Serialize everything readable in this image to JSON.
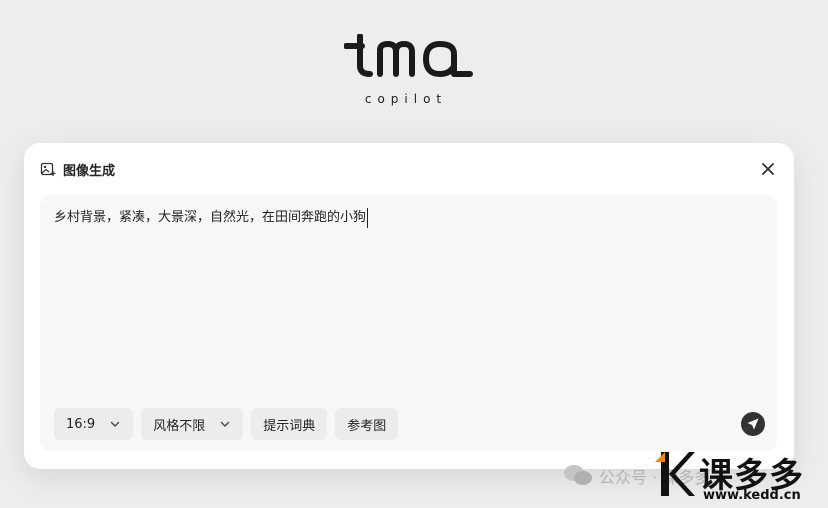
{
  "logo": {
    "wordmark": "ima",
    "subtitle": "copilot"
  },
  "dialog": {
    "title": "图像生成",
    "title_icon": "image-generate-icon",
    "close_icon": "close-icon",
    "prompt_value": "乡村背景，紧凑，大景深，自然光，在田间奔跑的小狗",
    "toolbar": {
      "ratio": {
        "value": "16:9",
        "icon": "chevron-down-icon"
      },
      "style": {
        "value": "风格不限",
        "icon": "chevron-down-icon"
      },
      "dictionary_label": "提示词典",
      "reference_label": "参考图"
    },
    "send_icon": "send-icon"
  },
  "watermark": {
    "channel_text": "公众号 · 课多多",
    "brand": "课多多",
    "url": "www.kedd.cn",
    "accent_color": "#f08a00"
  }
}
